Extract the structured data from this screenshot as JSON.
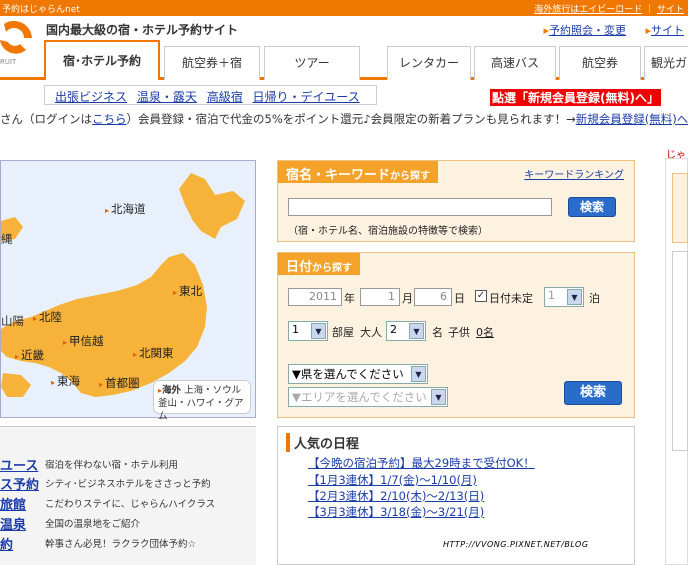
{
  "topbar": {
    "left": "予約はじゃらんnet",
    "right": [
      "海外旅行はエイビーロード",
      "サイト"
    ]
  },
  "header": {
    "tagline": "国内最大級の宿・ホテル予約サイト",
    "links": [
      "予約照会・変更",
      "サイト"
    ]
  },
  "tabs": [
    "宿･ホテル予約",
    "航空券＋宿",
    "ツアー",
    "レンタカー",
    "高速バス",
    "航空券",
    "観光ガ"
  ],
  "subnav": [
    "出張ビジネス",
    "温泉・露天",
    "高級宿",
    "日帰り・デイユース"
  ],
  "promo": "點選「新規会員登録(無料)へ」",
  "notice": {
    "prefix": "さん（ログインは",
    "link": "こちら",
    "mid": "）会員登録・宿泊で代金の5%をポイント還元♪会員限定の新着プランも見られます！→",
    "link2": "新規会員登録(無料)へ"
  },
  "jara_text": "じゃら",
  "map": {
    "regions": [
      "北海道",
      "東北",
      "北陸",
      "北関東",
      "甲信越",
      "近畿",
      "東海",
      "首都圏"
    ],
    "partials": [
      "縄",
      "山陽"
    ],
    "overseas_title": "海外",
    "overseas_lines": [
      "上海・ソウル",
      "釜山・ハワイ・グアム"
    ]
  },
  "leftlist": [
    {
      "k": "ユース",
      "d": "宿泊を伴わない宿・ホテル利用"
    },
    {
      "k": "ス予約",
      "d": "シティ･ビジネスホテルをささっと予約"
    },
    {
      "k": "旅館",
      "d": "こだわりステイに、じゃらんハイクラス"
    },
    {
      "k": "温泉",
      "d": "全国の温泉地をご紹介"
    },
    {
      "k": "約",
      "d": "幹事さん必見！ラクラク団体予約☆"
    }
  ],
  "keyword": {
    "title": "宿名・キーワード",
    "title_small": "から探す",
    "ranking": "キーワードランキング",
    "button": "検索",
    "hint": "（宿・ホテル名、宿泊施設の特徴等で検索）"
  },
  "date": {
    "title": "日付",
    "title_small": "から探す",
    "year": "2011",
    "year_l": "年",
    "month": "1",
    "month_l": "月",
    "day": "6",
    "day_l": "日",
    "undecided": "日付未定",
    "nights": "1",
    "nights_l": "泊",
    "rooms": "1",
    "rooms_l": "部屋",
    "adults_l": "大人",
    "adults": "2",
    "name_l": "名",
    "child_l": "子供",
    "child": "0名",
    "pref": "▼県を選んでください",
    "area": "▼エリアを選んでください",
    "button": "検索"
  },
  "popular": {
    "title": "人気の日程",
    "items": [
      "【今晩の宿泊予約】最大29時まで受付OK！",
      "【1月3連休】1/7(金)～1/10(月)",
      "【2月3連休】2/10(木)～2/13(日)",
      "【3月3連休】3/18(金)～3/21(月)"
    ]
  },
  "watermark": "HTTP://VVONG.PIXNET.NET/BLOG",
  "colors": {
    "brand": "#f07800",
    "panel": "#f5a22a",
    "button": "#2a6cc9",
    "link": "#1a3caa",
    "promo": "#e00000"
  }
}
